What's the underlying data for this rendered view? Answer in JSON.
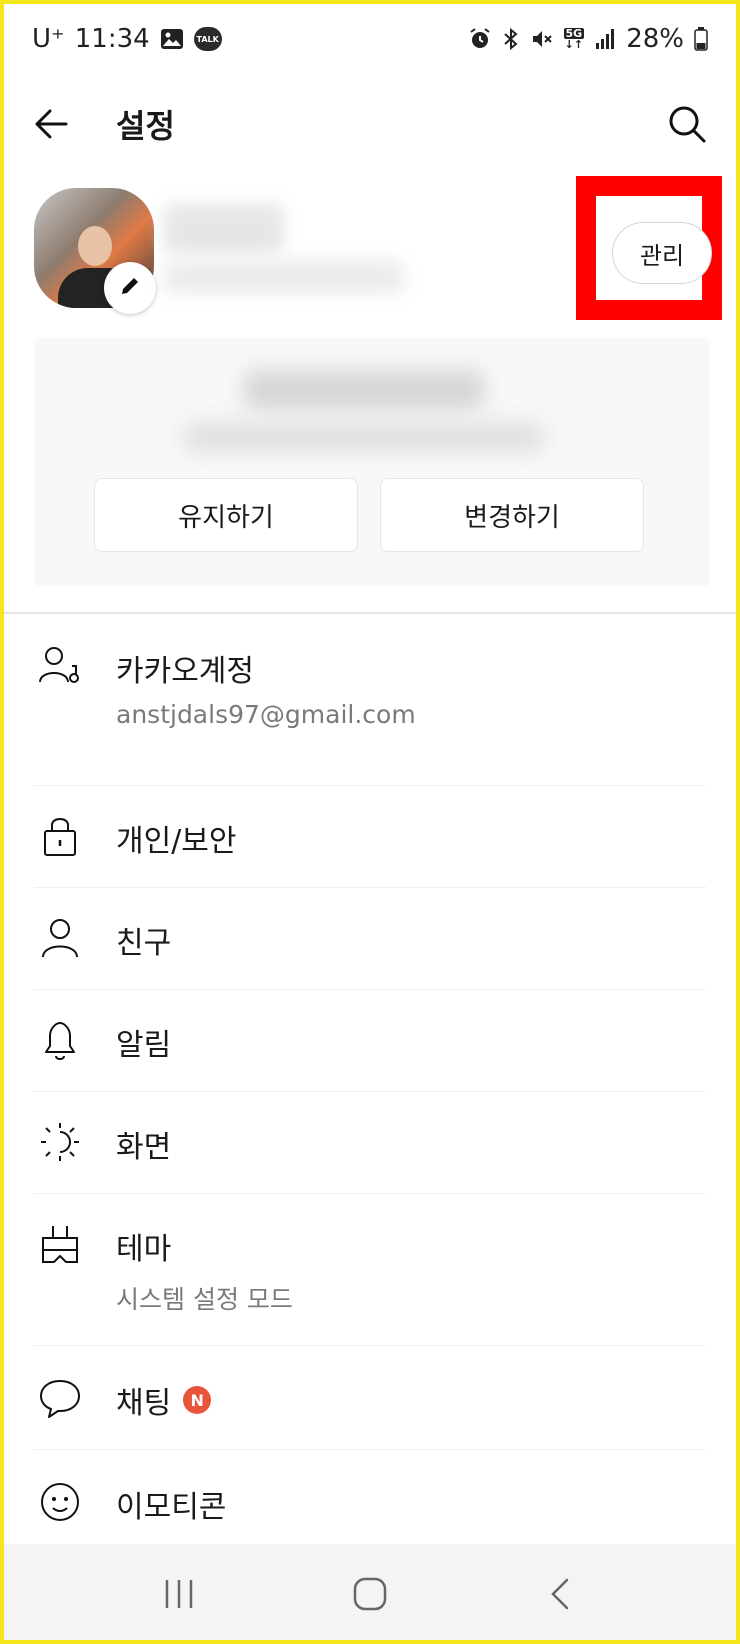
{
  "status_bar": {
    "carrier": "U⁺",
    "time": "11:34",
    "talk_badge": "TALK",
    "network": "5G",
    "battery": "28%",
    "icons": [
      "image-icon",
      "kakaotalk-icon",
      "alarm-icon",
      "bluetooth-icon",
      "mute-icon",
      "5g-icon",
      "signal-icon",
      "battery-icon"
    ]
  },
  "header": {
    "title": "설정"
  },
  "profile": {
    "manage_label": "관리"
  },
  "suggestion": {
    "keep_label": "유지하기",
    "change_label": "변경하기"
  },
  "menu": {
    "items": [
      {
        "label": "카카오계정",
        "sub": "anstjdals97@gmail.com",
        "icon": "account-icon"
      },
      {
        "label": "개인/보안",
        "icon": "lock-icon"
      },
      {
        "label": "친구",
        "icon": "person-icon"
      },
      {
        "label": "알림",
        "icon": "bell-icon"
      },
      {
        "label": "화면",
        "icon": "display-icon"
      },
      {
        "label": "테마",
        "sub": "시스템 설정 모드",
        "icon": "theme-icon"
      },
      {
        "label": "채팅",
        "badge": "N",
        "icon": "chat-icon"
      },
      {
        "label": "이모티콘",
        "icon": "emoticon-icon"
      }
    ]
  },
  "accent_colors": {
    "highlight": "#ff0000",
    "new_badge": "#e8553b",
    "frame": "#f5e61b"
  }
}
